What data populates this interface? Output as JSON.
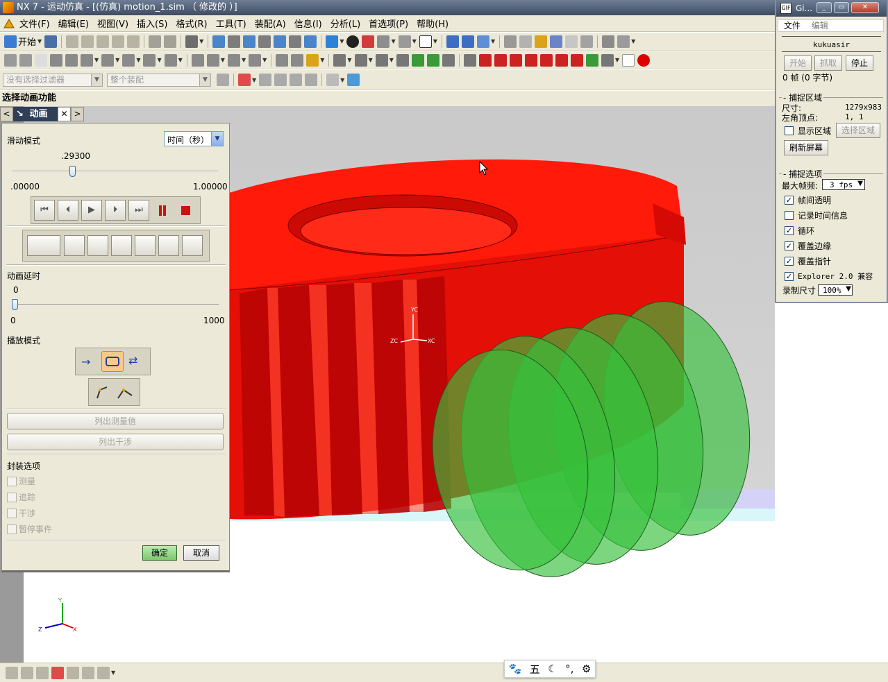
{
  "window": {
    "title": "NX 7 - 运动仿真 - [(仿真) motion_1.sim （ 修改的 ）]"
  },
  "menu": [
    {
      "label": "文件(F)"
    },
    {
      "label": "编辑(E)"
    },
    {
      "label": "视图(V)"
    },
    {
      "label": "插入(S)"
    },
    {
      "label": "格式(R)"
    },
    {
      "label": "工具(T)"
    },
    {
      "label": "装配(A)"
    },
    {
      "label": "信息(I)"
    },
    {
      "label": "分析(L)"
    },
    {
      "label": "首选项(P)"
    },
    {
      "label": "帮助(H)"
    }
  ],
  "toolbar": {
    "start_label": "开始",
    "filter_placeholder": "没有选择过滤器",
    "assembly_scope": "整个装配"
  },
  "cue": "选择动画功能",
  "resource_tab": {
    "label": "动画",
    "prev_icon": "chevron-left-icon",
    "next_icon": "chevron-right-icon",
    "close_icon": "close-icon"
  },
  "dialog": {
    "slide_mode_label": "滑动模式",
    "slide_mode_value": "时间（秒）",
    "slider": {
      "value_label": ".29300",
      "min_label": ".00000",
      "max_label": "1.00000",
      "fraction": 0.293
    },
    "delay_label": "动画延时",
    "delay_slider": {
      "value_label": "0",
      "min_label": "0",
      "max_label": "1000",
      "fraction": 0.0
    },
    "playback_label": "播放模式",
    "list_measures": "列出测量值",
    "list_interference": "列出干涉",
    "package_label": "封装选项",
    "package_options": [
      {
        "label": "测量"
      },
      {
        "label": "追踪"
      },
      {
        "label": "干涉"
      },
      {
        "label": "暂停事件"
      }
    ],
    "ok": "确定",
    "cancel": "取消"
  },
  "gifcam": {
    "title": "Gi...",
    "menu_file": "文件",
    "menu_edit": "编辑",
    "user_name": "kukuasir",
    "btn_start": "开始",
    "btn_capture": "抓取",
    "btn_stop": "停止",
    "frames_info": "0 帧 (0 字节)",
    "capture_region_label": "捕捉区域",
    "size_label": "尺寸:",
    "size_value": "1279x983",
    "corner_label": "左角顶点:",
    "corner_value": "1, 1",
    "show_region": "显示区域",
    "select_region": "选择区域",
    "refresh_screen": "刷新屏幕",
    "capture_options_label": "捕捉选项",
    "max_fps_label": "最大帧频:",
    "max_fps_value": "3 fps",
    "options": [
      {
        "label": "帧间透明",
        "checked": true
      },
      {
        "label": "记录时间信息",
        "checked": false
      },
      {
        "label": "循环",
        "checked": true
      },
      {
        "label": "覆盖边缘",
        "checked": true
      },
      {
        "label": "覆盖指针",
        "checked": true
      },
      {
        "label": "Explorer 2.0 兼容",
        "checked": true
      }
    ],
    "record_size_label": "录制尺寸",
    "record_size_value": "100%"
  },
  "viewport": {
    "triad_labels": {
      "yc": "YC",
      "zc": "ZC",
      "xc": "XC"
    },
    "small_triad": {
      "y": "Y",
      "z": "Z",
      "x": "X"
    }
  },
  "ime_bar": {
    "char": "五"
  },
  "colors": {
    "gear": "#ff1a0a",
    "worm": "#36c03a",
    "title_bar": "#4f5d73",
    "panel": "#ece9d8"
  }
}
